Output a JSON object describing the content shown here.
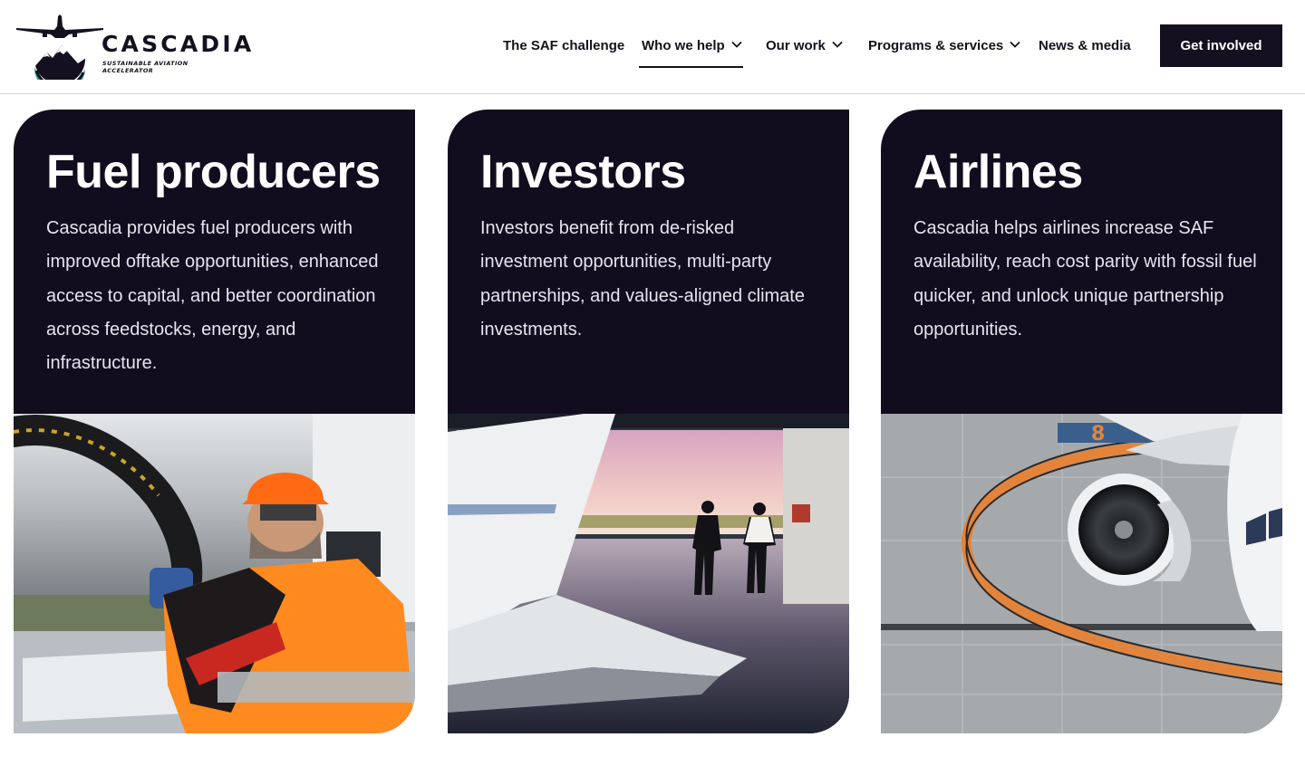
{
  "brand": {
    "name": "CASCADIA",
    "tagline": "SUSTAINABLE AVIATION ACCELERATOR",
    "colors": {
      "ink": "#15101f",
      "card": "#120d1e",
      "accent_teal": "#3aa58c"
    }
  },
  "nav": {
    "items": [
      {
        "label": "The SAF challenge",
        "dropdown": false
      },
      {
        "label": "Who we help",
        "dropdown": true,
        "active": true
      },
      {
        "label": "Our work",
        "dropdown": true
      },
      {
        "label": "Programs & services",
        "dropdown": true
      },
      {
        "label": "News & media",
        "dropdown": false
      }
    ],
    "cta_label": "Get involved"
  },
  "cards": [
    {
      "title": "Fuel producers",
      "text": "Cascadia provides fuel producers with improved offtake opportunities, enhanced access to capital, and better coordination across feedstocks, energy, and infrastructure.",
      "image_alt": "worker-refueling-hose-photo"
    },
    {
      "title": "Investors",
      "text": "Investors benefit from de-risked investment opportunities, multi-party partnerships, and values-aligned climate investments.",
      "image_alt": "hangar-silhouettes-photo"
    },
    {
      "title": "Airlines",
      "text": "Cascadia helps airlines increase SAF availability, reach cost parity with fossil fuel quicker, and unlock unique partnership opportunities.",
      "image_alt": "jet-engine-tarmac-photo"
    }
  ]
}
